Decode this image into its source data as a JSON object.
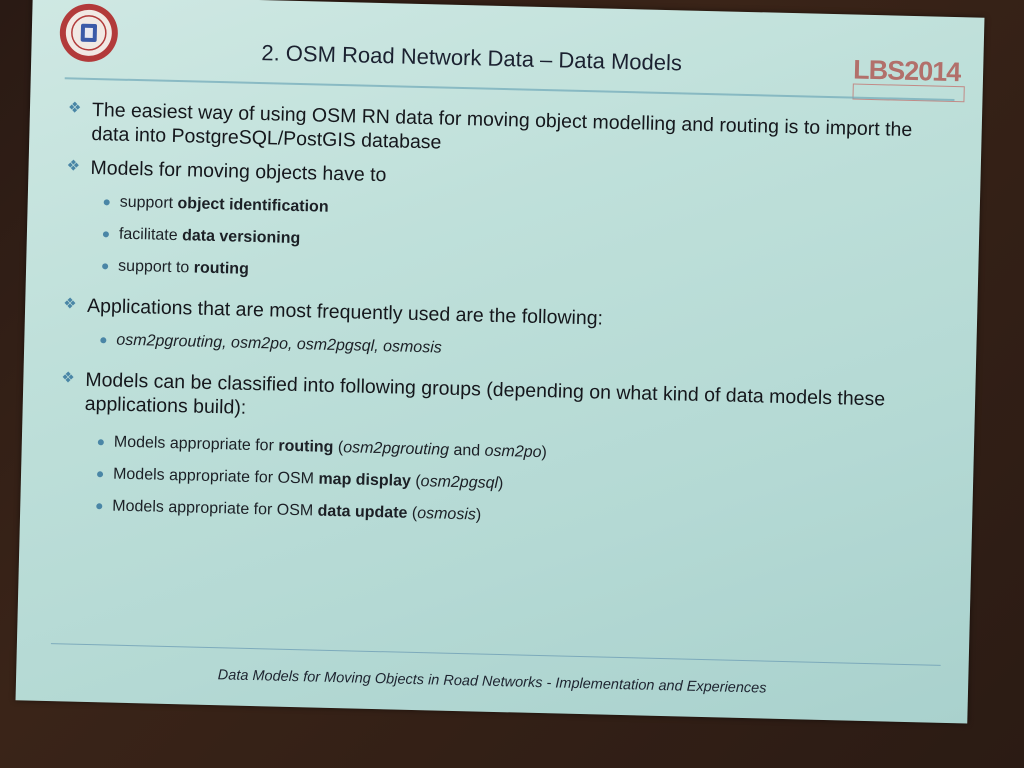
{
  "slide": {
    "title": "2. OSM Road Network Data – Data Models",
    "logo_right_text": "LBS2014",
    "bullets": [
      {
        "text": "The easiest way of using OSM RN data for moving object modelling and routing is to import the data into PostgreSQL/PostGIS database",
        "sub": []
      },
      {
        "text": "Models for moving objects have to",
        "sub": [
          {
            "prefix": "support ",
            "bold": "object identification",
            "suffix": ""
          },
          {
            "prefix": "facilitate ",
            "bold": "data versioning",
            "suffix": ""
          },
          {
            "prefix": "support to ",
            "bold": "routing",
            "suffix": ""
          }
        ]
      },
      {
        "text": "Applications that are most frequently used are the following:",
        "sub": [
          {
            "italic": "osm2pgrouting, osm2po, osm2pgsql, osmosis"
          }
        ]
      },
      {
        "text": "Models can be classified into following groups (depending on what kind of data models these applications build):",
        "sub": [
          {
            "prefix": "Models appropriate for ",
            "bold": "routing",
            "mid": " (",
            "i1": "osm2pgrouting",
            "and": " and ",
            "i2": "osm2po",
            "suffix": ")"
          },
          {
            "prefix": "Models appropriate for OSM ",
            "bold": "map display",
            "mid": " (",
            "i1": "osm2pgsql",
            "suffix": ")"
          },
          {
            "prefix": "Models appropriate for OSM ",
            "bold": "data update",
            "mid": " (",
            "i1": "osmosis",
            "suffix": ")"
          }
        ]
      }
    ],
    "footer": "Data Models for Moving Objects in Road Networks - Implementation and Experiences"
  },
  "icons": {
    "left_logo": "university-seal-icon",
    "bullet_main": "four-diamond-bullet-icon",
    "bullet_sub": "round-dot-bullet-icon"
  },
  "colors": {
    "slide_bg": "#bfe0da",
    "accent": "#4a86a6",
    "logo_red": "#b23a3a",
    "lbs_logo": "#b2706b"
  }
}
